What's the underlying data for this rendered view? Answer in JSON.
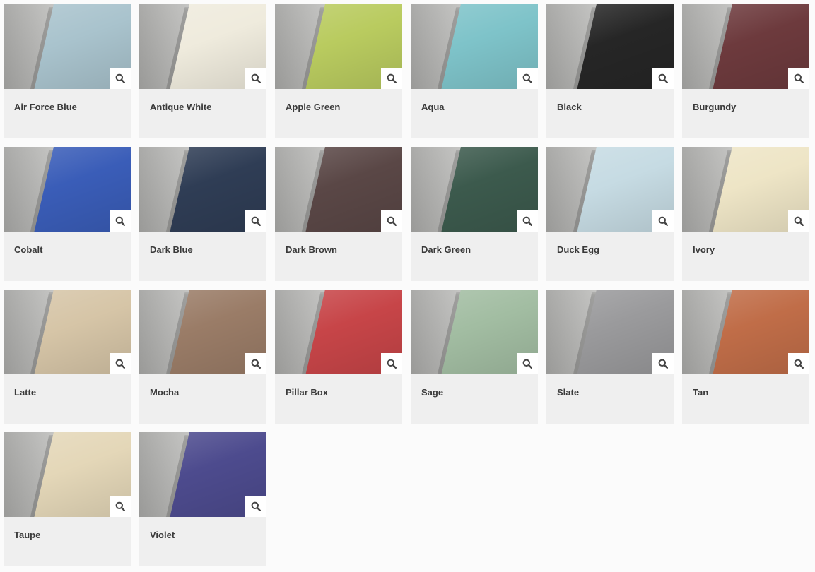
{
  "swatches": [
    {
      "name": "Air Force Blue",
      "color": "#a9c3cd",
      "icon": "magnifier-icon"
    },
    {
      "name": "Antique White",
      "color": "#efebdd",
      "icon": "magnifier-icon"
    },
    {
      "name": "Apple Green",
      "color": "#b9cb5f",
      "icon": "magnifier-icon"
    },
    {
      "name": "Aqua",
      "color": "#7ec3c9",
      "icon": "magnifier-icon"
    },
    {
      "name": "Black",
      "color": "#262626",
      "icon": "magnifier-icon"
    },
    {
      "name": "Burgundy",
      "color": "#6d3a3d",
      "icon": "magnifier-icon"
    },
    {
      "name": "Cobalt",
      "color": "#3a5db8",
      "icon": "magnifier-icon"
    },
    {
      "name": "Dark Blue",
      "color": "#2f3d55",
      "icon": "magnifier-icon"
    },
    {
      "name": "Dark Brown",
      "color": "#5a4746",
      "icon": "magnifier-icon"
    },
    {
      "name": "Dark Green",
      "color": "#3c5a4d",
      "icon": "magnifier-icon"
    },
    {
      "name": "Duck Egg",
      "color": "#c6dbe3",
      "icon": "magnifier-icon"
    },
    {
      "name": "Ivory",
      "color": "#eee5c6",
      "icon": "magnifier-icon"
    },
    {
      "name": "Latte",
      "color": "#d6c5a7",
      "icon": "magnifier-icon"
    },
    {
      "name": "Mocha",
      "color": "#9a7c67",
      "icon": "magnifier-icon"
    },
    {
      "name": "Pillar Box",
      "color": "#c74548",
      "icon": "magnifier-icon"
    },
    {
      "name": "Sage",
      "color": "#a2bda2",
      "icon": "magnifier-icon"
    },
    {
      "name": "Slate",
      "color": "#9a9a9c",
      "icon": "magnifier-icon"
    },
    {
      "name": "Tan",
      "color": "#c06d48",
      "icon": "magnifier-icon"
    },
    {
      "name": "Taupe",
      "color": "#e4d7b8",
      "icon": "magnifier-icon"
    },
    {
      "name": "Violet",
      "color": "#4d4b8e",
      "icon": "magnifier-icon"
    }
  ]
}
